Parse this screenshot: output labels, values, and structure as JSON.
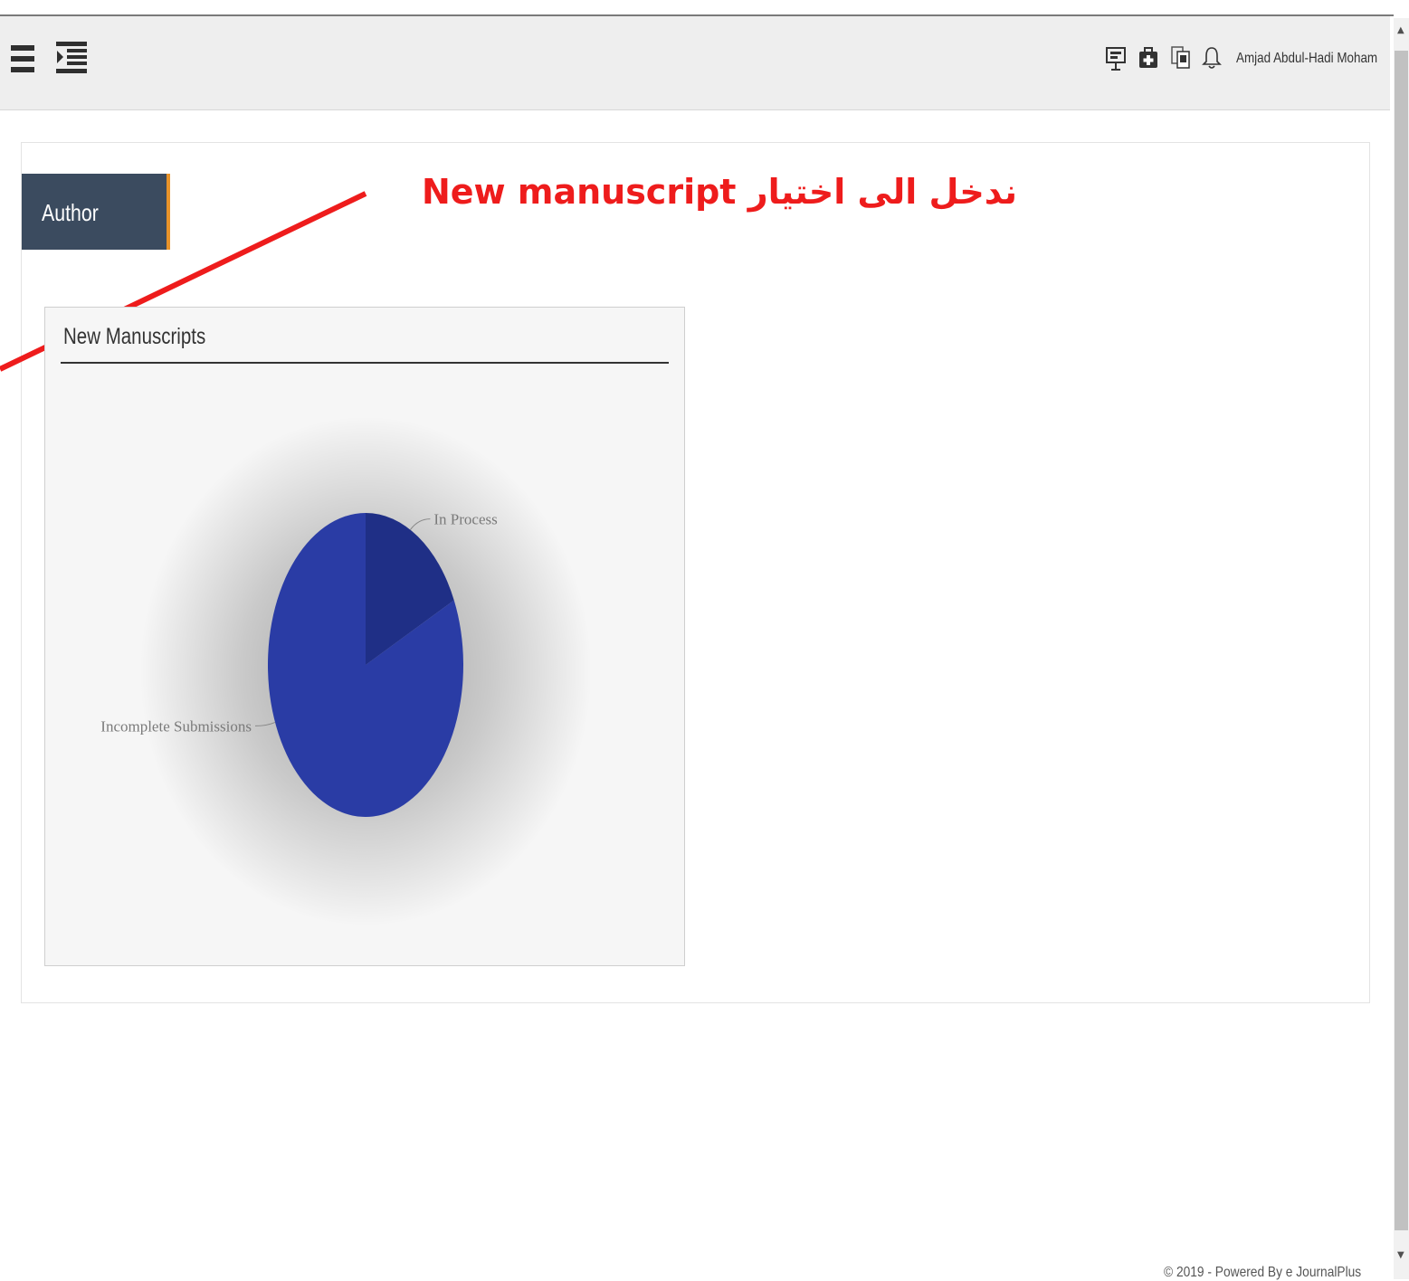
{
  "header": {
    "user_name": "Amjad Abdul-Hadi Moham",
    "icons": [
      "menu-icon",
      "indent-menu-icon",
      "presentation-icon",
      "first-aid-icon",
      "documents-icon",
      "bell-icon"
    ]
  },
  "author_tab": {
    "label": "Author"
  },
  "annotation": {
    "text": "ندخل الى اختيار New manuscript",
    "color": "#ee1c1c"
  },
  "widget": {
    "title": "New Manuscripts"
  },
  "chart_data": {
    "type": "pie",
    "title": "New Manuscripts",
    "categories": [
      "In Process",
      "Incomplete Submissions"
    ],
    "values": [
      18,
      82
    ],
    "colors": [
      "#1f2f86",
      "#2a3ca5"
    ],
    "legend": "none"
  },
  "footer": {
    "text": "© 2019 - Powered By e JournalPlus"
  },
  "colors": {
    "author_tab_bg": "#3b4b5f",
    "author_tab_accent": "#e8932a",
    "navbar_bg": "#eeeeee"
  }
}
